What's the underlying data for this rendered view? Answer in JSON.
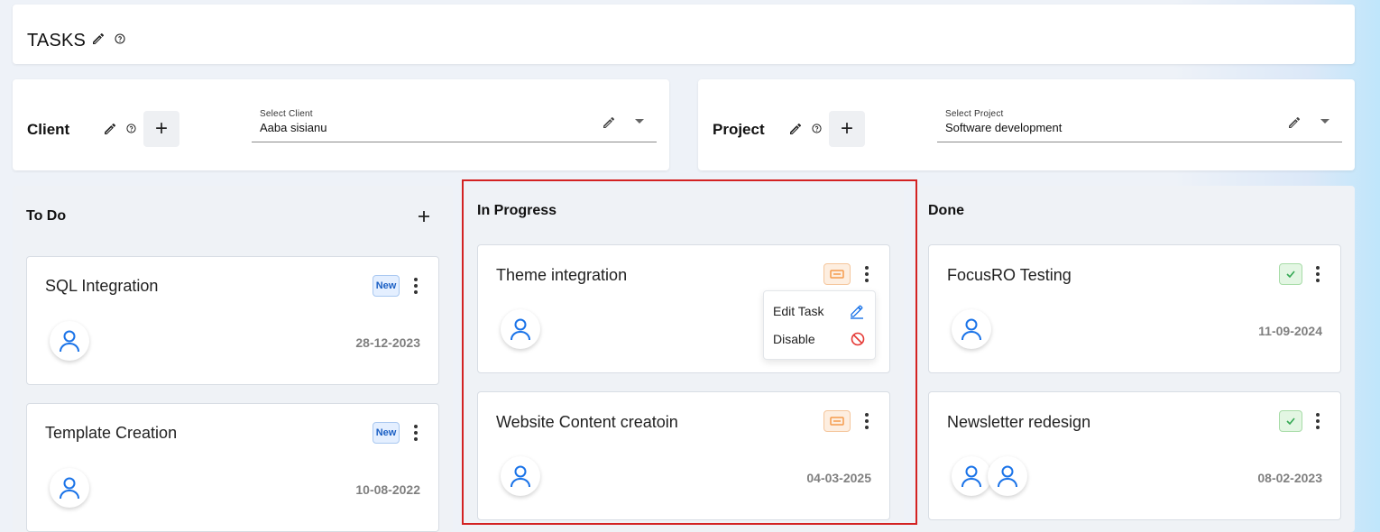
{
  "header": {
    "title": "TASKS"
  },
  "client": {
    "label": "Client",
    "select_label": "Select Client",
    "select_value": "Aaba sisianu"
  },
  "project": {
    "label": "Project",
    "select_label": "Select Project",
    "select_value": "Software development"
  },
  "columns": {
    "todo": {
      "title": "To Do",
      "cards": [
        {
          "title": "SQL Integration",
          "badge": "New",
          "date": "28-12-2023"
        },
        {
          "title": "Template Creation",
          "badge": "New",
          "date": "10-08-2022"
        }
      ]
    },
    "inprogress": {
      "title": "In Progress",
      "cards": [
        {
          "title": "Theme integration",
          "date": ""
        },
        {
          "title": "Website Content creatoin",
          "date": "04-03-2025"
        }
      ],
      "menu": {
        "edit": "Edit Task",
        "disable": "Disable"
      }
    },
    "done": {
      "title": "Done",
      "cards": [
        {
          "title": "FocusRO Testing",
          "date": "11-09-2024"
        },
        {
          "title": "Newsletter redesign",
          "date": "08-02-2023"
        }
      ]
    }
  },
  "colors": {
    "accent": "#1a73e8",
    "highlight": "#d32222",
    "danger": "#e53935",
    "progress_badge": "#f59b4c",
    "done_badge": "#34a853"
  },
  "icons": [
    "pencil-icon",
    "help-icon",
    "plus-icon",
    "chevron-down-icon",
    "user-icon",
    "kebab-icon",
    "ticket-icon",
    "check-icon",
    "edit-icon",
    "block-icon"
  ]
}
